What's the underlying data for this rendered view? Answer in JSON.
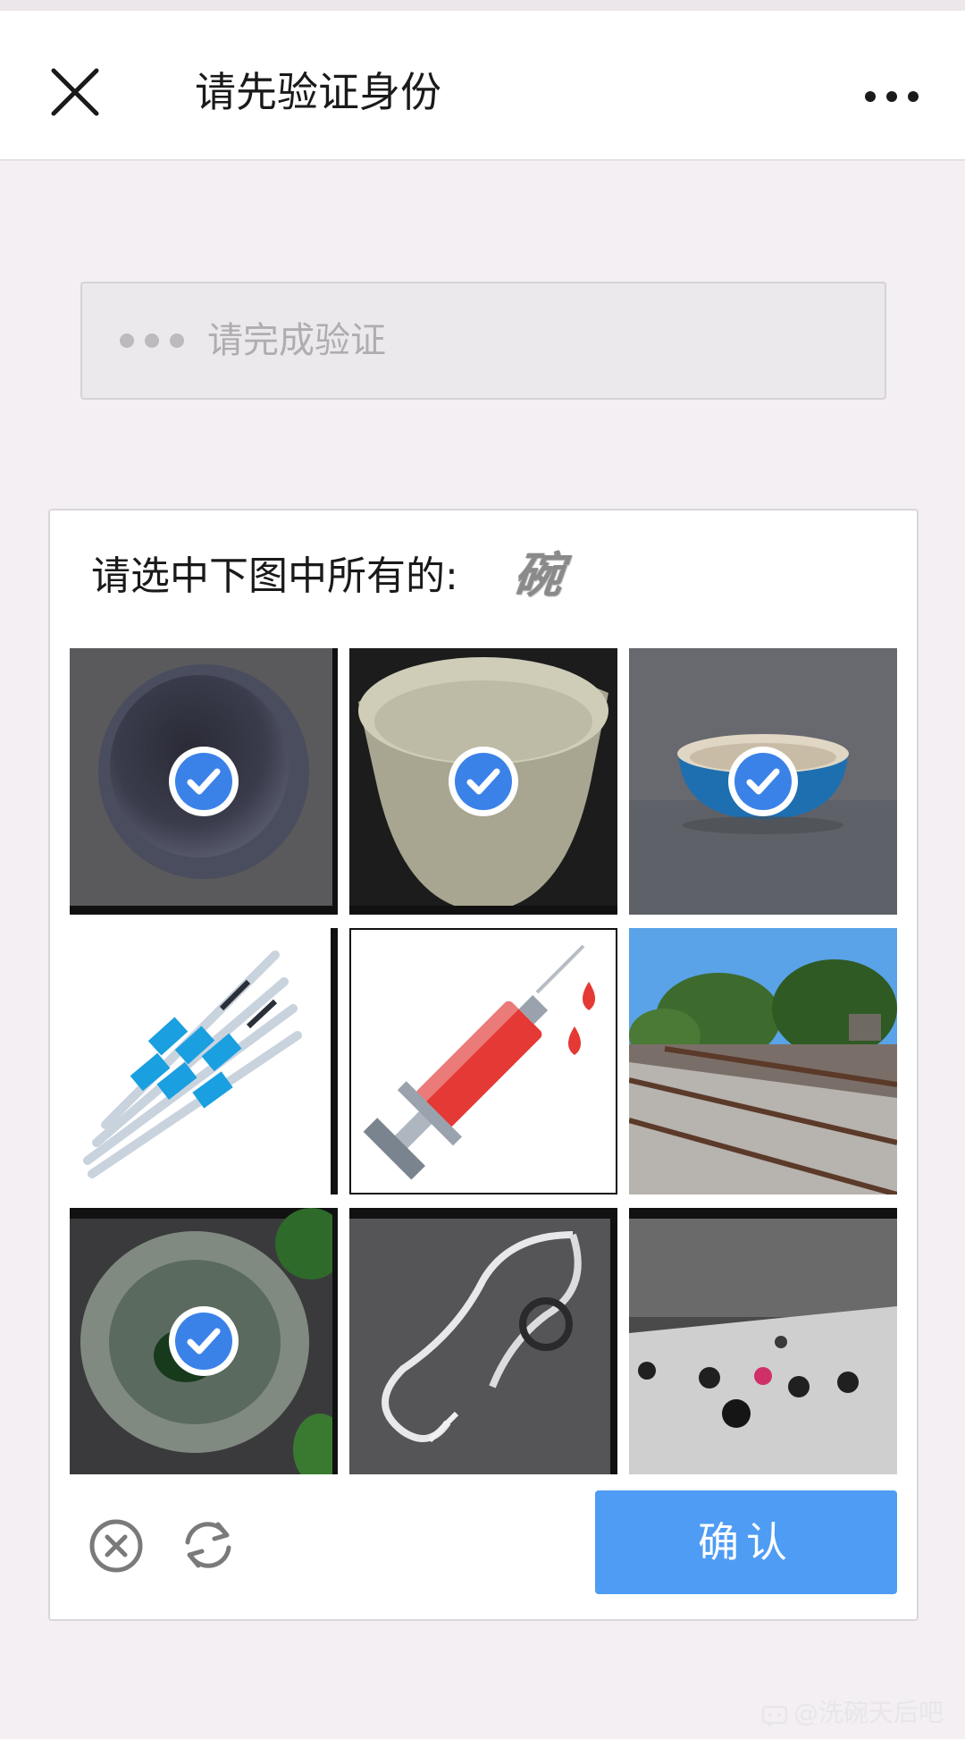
{
  "navbar": {
    "title": "请先验证身份",
    "close_icon": "close-icon",
    "more_icon": "more-dots-icon"
  },
  "status": {
    "text": "请完成验证",
    "icon": "loading-dots-icon"
  },
  "captcha": {
    "prompt": "请选中下图中所有的:",
    "target_word": "碗",
    "tiles": [
      {
        "subject": "dark bowl top view",
        "selected": true
      },
      {
        "subject": "beige bowl",
        "selected": true
      },
      {
        "subject": "blue bowl",
        "selected": true
      },
      {
        "subject": "syringes",
        "selected": false
      },
      {
        "subject": "syringe with blood drops",
        "selected": false
      },
      {
        "subject": "railway tracks",
        "selected": false
      },
      {
        "subject": "green bowl with leaves",
        "selected": true
      },
      {
        "subject": "stethoscope",
        "selected": false
      },
      {
        "subject": "billiard table",
        "selected": false
      }
    ],
    "cancel_icon": "circle-x-icon",
    "refresh_icon": "refresh-icon",
    "confirm_label": "确认"
  },
  "watermark": {
    "text": "@洗碗天后吧",
    "icon": "chat-bubble-icon"
  },
  "colors": {
    "accent": "#4e9cf4",
    "check": "#3b82e8",
    "background": "#f3eff3"
  }
}
